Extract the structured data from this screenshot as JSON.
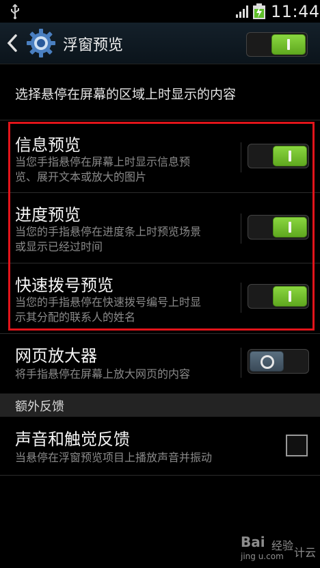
{
  "status_bar": {
    "time": "11:44",
    "icons": [
      "usb-icon",
      "signal-icon",
      "battery-charging-icon"
    ]
  },
  "header": {
    "title": "浮窗预览",
    "master_switch_on": true
  },
  "intro": "选择悬停在屏幕的区域上时显示的内容",
  "items": [
    {
      "title": "信息预览",
      "desc_lines": [
        "当您手指悬停在屏幕上时显示信息预",
        "览、展开文本或放大的图片"
      ],
      "on": true
    },
    {
      "title": "进度预览",
      "desc_lines": [
        "当您的手指悬停在进度条上时预览场景",
        "或显示已经过时间"
      ],
      "on": true
    },
    {
      "title": "快速拨号预览",
      "desc_lines": [
        "当您的手指悬停在快速拨号编号上时显",
        "示其分配的联系人的姓名"
      ],
      "on": true
    },
    {
      "title": "网页放大器",
      "desc_lines": [
        "将手指悬停在屏幕上放大网页的内容"
      ],
      "on": false
    }
  ],
  "section_header": "额外反馈",
  "feedback": {
    "title": "声音和触觉反馈",
    "desc": "当悬停在浮窗预览项目上播放声音并振动",
    "checked": false
  },
  "colors": {
    "toggle_on": "#6bbf2a",
    "toggle_off": "#4a5c6b",
    "highlight": "#e2141a"
  },
  "watermark": {
    "brand": "Bai",
    "brand2": "经验",
    "url": "jing   u.com",
    "other": "计云"
  }
}
